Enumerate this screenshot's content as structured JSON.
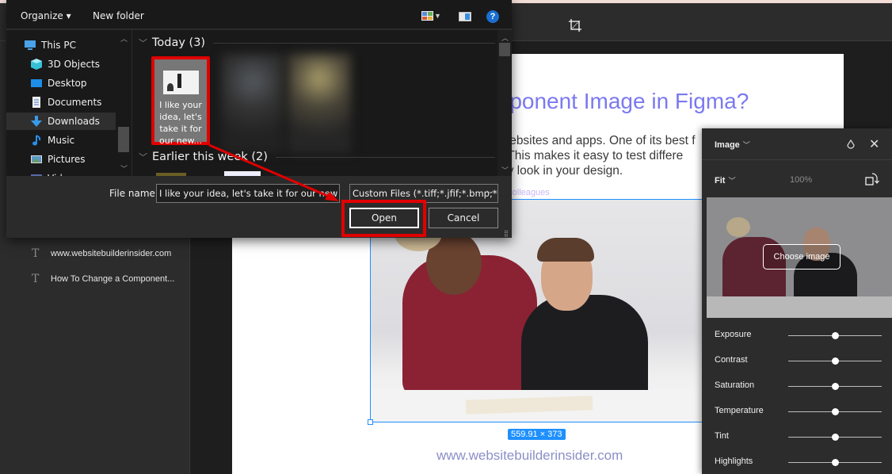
{
  "figma": {
    "toolbar": {
      "crop_icon": "crop-icon"
    },
    "layers": [
      {
        "icon": "text-icon",
        "label": "www.websitebuilderinsider.com"
      },
      {
        "icon": "text-icon",
        "label": "How To Change a Component..."
      }
    ],
    "frame": {
      "title": "mponent Image in Figma?",
      "paragraph_lines": [
        "websites and apps. One of its best f",
        ". This makes it easy to test differe",
        "ey look in your design."
      ],
      "caption_link": "n colleagues",
      "selection_dimensions": "559.91 × 373",
      "footer": "www.websitebuilderinsider.com"
    },
    "image_panel": {
      "type_label": "Image",
      "fit_label": "Fit",
      "zoom_percent": "100%",
      "choose_image_label": "Choose image",
      "adjustments": [
        {
          "label": "Exposure",
          "value": 0
        },
        {
          "label": "Contrast",
          "value": 0
        },
        {
          "label": "Saturation",
          "value": 0
        },
        {
          "label": "Temperature",
          "value": 0
        },
        {
          "label": "Tint",
          "value": 0
        },
        {
          "label": "Highlights",
          "value": 0
        }
      ]
    }
  },
  "dialog": {
    "toolbar": {
      "organize_label": "Organize ▾",
      "new_folder_label": "New folder",
      "help_label": "?"
    },
    "nav": [
      {
        "label": "This PC",
        "icon": "computer-icon",
        "selected": false
      },
      {
        "label": "3D Objects",
        "icon": "cube-icon",
        "selected": false
      },
      {
        "label": "Desktop",
        "icon": "desktop-icon",
        "selected": false
      },
      {
        "label": "Documents",
        "icon": "document-icon",
        "selected": false
      },
      {
        "label": "Downloads",
        "icon": "download-arrow-icon",
        "selected": true
      },
      {
        "label": "Music",
        "icon": "music-note-icon",
        "selected": false
      },
      {
        "label": "Pictures",
        "icon": "picture-icon",
        "selected": false
      },
      {
        "label": "Vid",
        "icon": "video-icon",
        "selected": false
      }
    ],
    "groups": [
      {
        "label": "Today (3)"
      },
      {
        "label": "Earlier this week (2)"
      }
    ],
    "selected_file_name": "I like your idea, let's take it for our new...",
    "file_name_label": "File name:",
    "file_name_value": "I like your idea, let's take it for our new f",
    "file_type_value": "Custom Files (*.tiff;*.jfif;*.bmp;*",
    "open_label": "Open",
    "cancel_label": "Cancel"
  },
  "annotation_colors": {
    "highlight": "#e00000"
  }
}
